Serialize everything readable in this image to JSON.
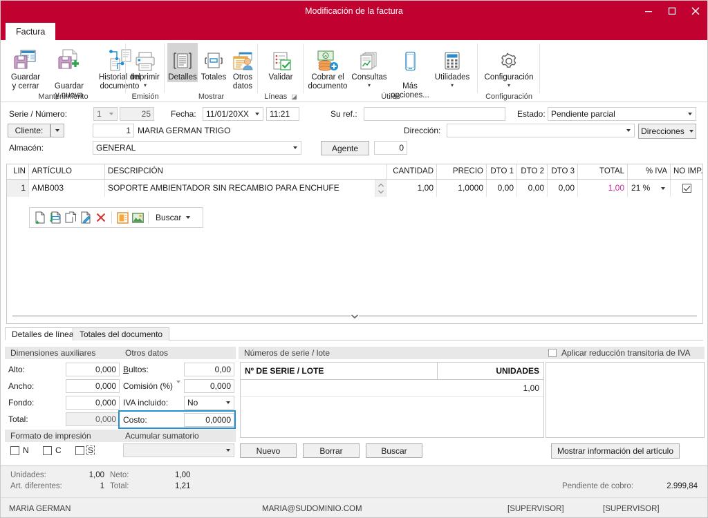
{
  "window": {
    "title": "Modificación de la factura",
    "accent_color": "#C10230",
    "buttons": {
      "minimize": "minimize-icon",
      "maximize": "maximize-icon",
      "close": "close-icon"
    }
  },
  "ribbon": {
    "tab": "Factura",
    "groups": [
      {
        "caption": "Mantenimiento",
        "items": [
          {
            "label": "Guardar\ny cerrar",
            "icon": "save-close-icon",
            "caret": false
          },
          {
            "label": "Guardar\ny nueva",
            "icon": "save-new-icon",
            "caret": "inline"
          },
          {
            "label": "Historial del\ndocumento",
            "icon": "document-history-icon",
            "caret": false
          }
        ]
      },
      {
        "caption": "Emisión",
        "items": [
          {
            "label": "Imprimir",
            "icon": "printer-icon",
            "caret": true
          }
        ]
      },
      {
        "caption": "Mostrar",
        "items": [
          {
            "label": "Detalles",
            "icon": "details-icon",
            "caret": false,
            "active": true
          },
          {
            "label": "Totales",
            "icon": "totals-icon",
            "caret": false
          },
          {
            "label": "Otros\ndatos",
            "icon": "other-data-icon",
            "caret": false
          }
        ]
      },
      {
        "caption": "Líneas",
        "dialog_launcher": true,
        "items": [
          {
            "label": "Validar",
            "icon": "validate-icon",
            "caret": false
          }
        ]
      },
      {
        "caption": "Útiles",
        "items": [
          {
            "label": "Cobrar el\ndocumento",
            "icon": "collect-money-icon",
            "caret": false
          },
          {
            "label": "Consultas",
            "icon": "queries-icon",
            "caret": true
          },
          {
            "label": "Más\nopciones...",
            "icon": "more-options-icon",
            "caret": "inline"
          },
          {
            "label": "Utilidades",
            "icon": "utilities-icon",
            "caret": true
          }
        ]
      },
      {
        "caption": "Configuración",
        "items": [
          {
            "label": "Configuración",
            "icon": "gear-icon",
            "caret": true
          }
        ]
      }
    ]
  },
  "header": {
    "serie_numero_label": "Serie / Número:",
    "serie_value": "1",
    "numero_value": "25",
    "fecha_label": "Fecha:",
    "fecha_value": "11/01/20XX",
    "hora_value": "11:21",
    "su_ref_label": "Su ref.:",
    "su_ref_value": "",
    "estado_label": "Estado:",
    "estado_value": "Pendiente parcial",
    "cliente_label": "Cliente:",
    "cliente_code": "1",
    "cliente_name": "MARIA GERMAN TRIGO",
    "direccion_label": "Dirección:",
    "direccion_value": "",
    "direcciones_button": "Direcciones",
    "almacen_label": "Almacén:",
    "almacen_value": "GENERAL",
    "agente_button": "Agente",
    "agente_value": "0"
  },
  "lines_grid": {
    "columns": [
      {
        "key": "lin",
        "label": "LIN"
      },
      {
        "key": "articulo",
        "label": "ARTÍCULO"
      },
      {
        "key": "descripcion",
        "label": "DESCRIPCIÓN"
      },
      {
        "key": "cantidad",
        "label": "CANTIDAD"
      },
      {
        "key": "precio",
        "label": "PRECIO"
      },
      {
        "key": "dto1",
        "label": "DTO 1"
      },
      {
        "key": "dto2",
        "label": "DTO 2"
      },
      {
        "key": "dto3",
        "label": "DTO 3"
      },
      {
        "key": "total",
        "label": "TOTAL"
      },
      {
        "key": "iva",
        "label": "% IVA"
      },
      {
        "key": "noimp",
        "label": "NO IMP."
      }
    ],
    "rows": [
      {
        "lin": "1",
        "articulo": "AMB003",
        "descripcion": "SOPORTE AMBIENTADOR SIN RECAMBIO PARA ENCHUFE",
        "cantidad": "1,00",
        "precio": "1,0000",
        "dto1": "0,00",
        "dto2": "0,00",
        "dto3": "0,00",
        "total": "1,00",
        "iva": "21 %",
        "noimp": true
      }
    ],
    "total_color": "#C72BA0",
    "toolbar": {
      "icons": [
        "new-line-icon",
        "insert-line-icon",
        "copy-line-icon",
        "edit-line-icon",
        "delete-line-icon",
        "notes-icon",
        "image-icon"
      ],
      "search_label": "Buscar"
    }
  },
  "bottom_tabs": [
    {
      "label": "Detalles de línea",
      "selected": true
    },
    {
      "label": "Totales del documento",
      "selected": false
    }
  ],
  "dimensiones": {
    "title": "Dimensiones auxiliares",
    "fields": [
      {
        "label": "Alto:",
        "value": "0,000",
        "readonly": false
      },
      {
        "label": "Ancho:",
        "value": "0,000",
        "readonly": false
      },
      {
        "label": "Fondo:",
        "value": "0,000",
        "readonly": false
      },
      {
        "label": "Total:",
        "value": "0,000",
        "readonly": true
      }
    ],
    "formato_title": "Formato de impresión",
    "checks": [
      {
        "label": "N",
        "checked": false,
        "focused": false
      },
      {
        "label": "C",
        "checked": false,
        "focused": false
      },
      {
        "label": "S",
        "checked": false,
        "focused": true
      }
    ]
  },
  "otros_datos": {
    "title": "Otros datos",
    "bultos_label": "Bultos:",
    "bultos_value": "0,00",
    "comision_label": "Comisión (%)",
    "comision_value": "0,000",
    "iva_incluido_label": "IVA incluido:",
    "iva_incluido_value": "No",
    "costo_label": "Costo:",
    "costo_value": "0,0000",
    "acumular_title": "Acumular sumatorio",
    "acumular_value": ""
  },
  "serie_lote": {
    "title": "Números de serie / lote",
    "columns": [
      {
        "label": "Nº DE SERIE / LOTE"
      },
      {
        "label": "UNIDADES"
      }
    ],
    "rows": [
      {
        "serie": "",
        "unidades": "1,00"
      }
    ],
    "buttons": [
      "Nuevo",
      "Borrar",
      "Buscar"
    ]
  },
  "right_panel": {
    "reduccion_checkbox_label": "Aplicar reducción transitoria de IVA",
    "reduccion_checked": false,
    "info_button": "Mostrar información del artículo"
  },
  "status_bar": {
    "unidades_label": "Unidades:",
    "unidades_value": "1,00",
    "neto_label": "Neto:",
    "neto_value": "1,00",
    "art_label": "Art. diferentes:",
    "art_value": "1",
    "total_label": "Total:",
    "total_value": "1,21",
    "pendiente_label": "Pendiente de cobro:",
    "pendiente_value": "2.999,84",
    "user_name": "MARIA GERMAN",
    "email": "MARIA@SUDOMINIO.COM",
    "role_left": "[SUPERVISOR]",
    "role_right": "[SUPERVISOR]"
  }
}
